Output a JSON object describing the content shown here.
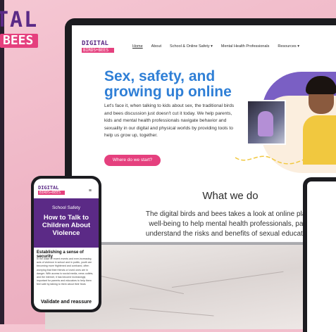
{
  "colors": {
    "brand_purple": "#5b2a86",
    "brand_pink": "#e5407e",
    "title_blue": "#2f7fd6",
    "background_pink": "#efb6c6"
  },
  "background_logo": {
    "line1": "TAL",
    "line2": "BEES"
  },
  "site": {
    "logo": {
      "line1": "DIGITAL",
      "line2": "BIRDS+BEES"
    },
    "nav": [
      {
        "label": "Home",
        "active": true
      },
      {
        "label": "About"
      },
      {
        "label": "School & Online Safety ▾"
      },
      {
        "label": "Mental Health Professionals"
      },
      {
        "label": "Resources ▾"
      }
    ],
    "hero": {
      "title": "Sex, safety, and growing up online",
      "body": "Let's face it, when talking to kids about sex, the traditional birds and bees discussion just doesn't cut it today. We help parents, kids and mental health professionals navigate behavior and sexuality in our digital and physical worlds by providing tools to help us grow up, together.",
      "button": "Where do we start?"
    },
    "what_we_do": {
      "title": "What we do",
      "line1": "The digital birds and bees takes a look at online platform",
      "line2": "well-being to help mental health professionals, parents",
      "line3": "understand the risks and benefits of sexual education on"
    }
  },
  "phone": {
    "logo": {
      "line1": "DIGITAL",
      "line2": "BIRDS+BEES"
    },
    "menu_icon": "hamburger-icon",
    "menu_glyph": "≡",
    "subtitle": "School Safety",
    "title": "How to Talk to Children About Violence",
    "section_heading": "Establishing a sense of security",
    "body": "In the wake of recent events and ever-increasing acts of violence in school and in public, youth are becoming more frightened and confused, often worrying that their friends or loved ones are in danger. With access to social media, news outlets, and the internet, it has become increasingly important for parents and educators to help them feel safe by talking to them about their fears",
    "footer_heading": "Validate and reassure"
  }
}
